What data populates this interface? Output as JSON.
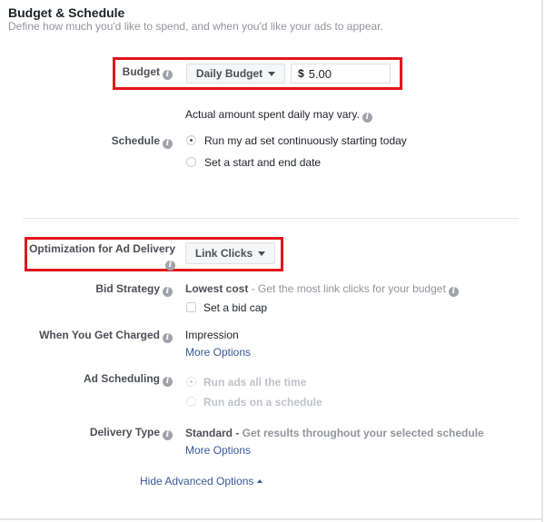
{
  "section": {
    "title": "Budget & Schedule",
    "subtitle": "Define how much you'd like to spend, and when you'd like your ads to appear."
  },
  "budget": {
    "label": "Budget",
    "type_dropdown": "Daily Budget",
    "currency": "$",
    "amount": "5.00",
    "note": "Actual amount spent daily may vary."
  },
  "schedule": {
    "label": "Schedule",
    "options": [
      {
        "label": "Run my ad set continuously starting today",
        "selected": true
      },
      {
        "label": "Set a start and end date",
        "selected": false
      }
    ]
  },
  "optimization": {
    "label": "Optimization for Ad Delivery",
    "dropdown": "Link Clicks"
  },
  "bid_strategy": {
    "label": "Bid Strategy",
    "value": "Lowest cost",
    "description": " - Get the most link clicks for your budget",
    "bid_cap_label": "Set a bid cap",
    "bid_cap_checked": false
  },
  "charged": {
    "label": "When You Get Charged",
    "value": "Impression",
    "more_options": "More Options"
  },
  "ad_scheduling": {
    "label": "Ad Scheduling",
    "options": [
      {
        "label": "Run ads all the time",
        "selected": true,
        "disabled": true
      },
      {
        "label": "Run ads on a schedule",
        "selected": false,
        "disabled": true
      }
    ]
  },
  "delivery_type": {
    "label": "Delivery Type",
    "value": "Standard -",
    "description": " Get results throughout your selected schedule",
    "more_options": "More Options"
  },
  "hide_advanced": "Hide Advanced Options",
  "colors": {
    "highlight": "#e3141c",
    "link": "#365899"
  },
  "icons": {
    "info": "info-icon",
    "dropdown": "caret-down-icon",
    "collapse": "caret-up-icon"
  }
}
